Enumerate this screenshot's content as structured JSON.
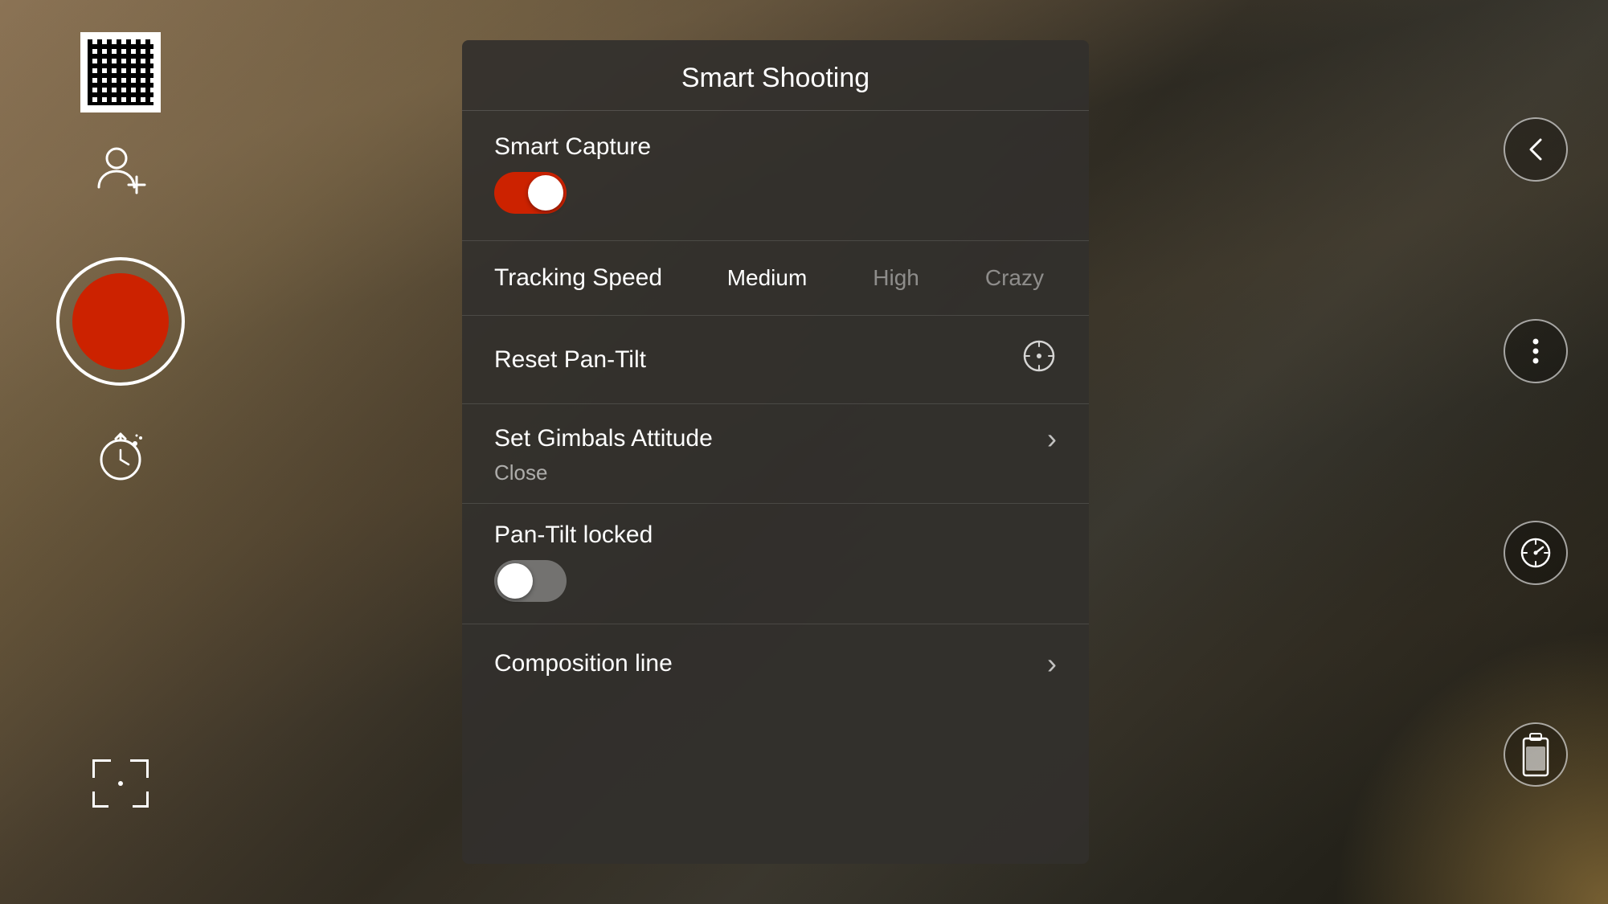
{
  "app": {
    "title": "Smart Shooting"
  },
  "panel": {
    "title": "Smart Shooting",
    "smart_capture": {
      "label": "Smart Capture",
      "enabled": true
    },
    "tracking_speed": {
      "label": "Tracking Speed",
      "options": [
        {
          "value": "Medium",
          "active": true
        },
        {
          "value": "High",
          "active": false
        },
        {
          "value": "Crazy",
          "active": false
        }
      ]
    },
    "reset_pan_tilt": {
      "label": "Reset Pan-Tilt"
    },
    "set_gimbals": {
      "label": "Set Gimbals Attitude",
      "sub_label": "Close"
    },
    "pan_tilt_locked": {
      "label": "Pan-Tilt locked",
      "enabled": false
    },
    "composition_line": {
      "label": "Composition line"
    }
  },
  "left_controls": {
    "record_button_label": "Record",
    "add_person_label": "Add Person",
    "focus_label": "Focus Frame"
  },
  "right_controls": {
    "back_label": "Back",
    "more_label": "More Options",
    "speed_label": "Speed Dial",
    "battery_label": "Battery"
  }
}
